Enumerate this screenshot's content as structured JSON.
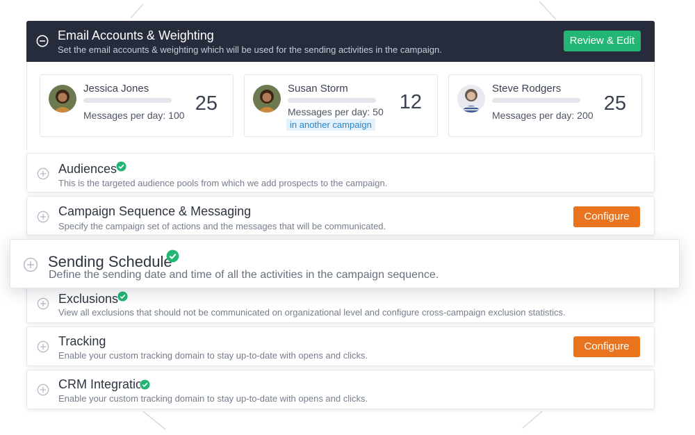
{
  "header": {
    "title": "Email Accounts & Weighting",
    "description": "Set the email accounts & weighting which will be used for the sending activities in the campaign.",
    "review_button": "Review & Edit",
    "icon": "minus-circle-icon"
  },
  "accounts": [
    {
      "name": "Jessica Jones",
      "messages": "Messages per day: 100",
      "count": "25",
      "tag": ""
    },
    {
      "name": "Susan Storm",
      "messages": "Messages per day: 50",
      "count": "12",
      "tag": "in another campaign"
    },
    {
      "name": "Steve Rodgers",
      "messages": "Messages per day: 200",
      "count": "25",
      "tag": ""
    }
  ],
  "sections": {
    "audiences": {
      "title": "Audiences",
      "description": "This is the targeted audience pools from which we add prospects to the campaign.",
      "icon": "plus-circle-icon",
      "completed": true
    },
    "sequence": {
      "title": "Campaign Sequence & Messaging",
      "description": "Specify the campaign set of actions and the messages that will be communicated.",
      "button": "Configure",
      "icon": "plus-circle-icon"
    },
    "schedule": {
      "title": "Sending Schedule",
      "description": "Define the sending date and time of all the activities in the campaign sequence.",
      "icon": "plus-circle-icon",
      "completed": true
    },
    "exclusions": {
      "title": "Exclusions",
      "description": "View all exclusions that should not be communicated on organizational level and configure cross-campaign exclusion statistics.",
      "icon": "plus-circle-icon",
      "completed": true
    },
    "tracking": {
      "title": "Tracking",
      "description": "Enable your custom tracking domain to stay up-to-date with opens and clicks.",
      "button": "Configure",
      "icon": "plus-circle-icon"
    },
    "crm": {
      "title": "CRM Integration",
      "description": "Enable your custom tracking domain to stay up-to-date with opens and clicks.",
      "icon": "plus-circle-icon",
      "completed": true
    }
  },
  "colors": {
    "header_bg": "#262c3b",
    "review_green": "#22b573",
    "configure_orange": "#ea741d",
    "check_green": "#22b573",
    "tag_blue": "#2a86c7"
  }
}
